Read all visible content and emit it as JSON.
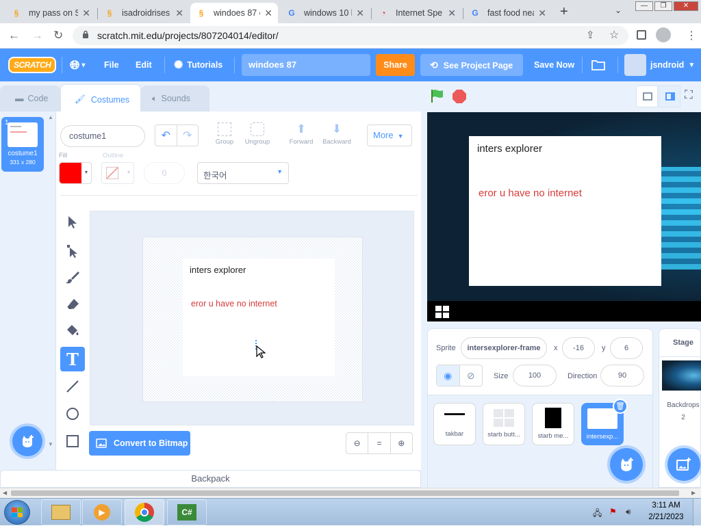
{
  "browser": {
    "tabs": [
      {
        "title": "my pass on S",
        "favicon": "scratch-favicon",
        "active": false
      },
      {
        "title": "isadroidrises",
        "favicon": "scratch-favicon",
        "active": false
      },
      {
        "title": "windoes 87 o",
        "favicon": "scratch-favicon",
        "active": true
      },
      {
        "title": "windows 10 l",
        "favicon": "google-favicon",
        "active": false
      },
      {
        "title": "Internet Spe",
        "favicon": "speedtest-favicon",
        "active": false
      },
      {
        "title": "fast food nea",
        "favicon": "google-favicon",
        "active": false
      }
    ],
    "url": "scratch.mit.edu/projects/807204014/editor/"
  },
  "menubar": {
    "logo": "SCRATCH",
    "file": "File",
    "edit": "Edit",
    "tutorials": "Tutorials",
    "project_title": "windoes 87",
    "share": "Share",
    "see_project": "See Project Page",
    "save_now": "Save Now",
    "username": "jsndroid"
  },
  "editor_tabs": {
    "code": "Code",
    "costumes": "Costumes",
    "sounds": "Sounds"
  },
  "costume_list": [
    {
      "number": "1",
      "name": "costume1",
      "size": "331 x 280"
    }
  ],
  "paint": {
    "costume_name": "costume1",
    "group": "Group",
    "ungroup": "Ungroup",
    "forward": "Forward",
    "backward": "Backward",
    "more": "More",
    "fill_label": "Fill",
    "outline_label": "Outline",
    "outline_width": "0",
    "font": "한국어",
    "fill_color": "#ff0000",
    "convert": "Convert to Bitmap",
    "canvas_title": "inters explorer",
    "canvas_message": "eror u have no internet"
  },
  "backpack": "Backpack",
  "stage": {
    "window_title": "inters explorer",
    "window_message": "eror u have no internet"
  },
  "sprite_info": {
    "sprite_label": "Sprite",
    "sprite_name": "intersexplorer-frame",
    "x_label": "x",
    "x": "-16",
    "y_label": "y",
    "y": "6",
    "show_label": "Show",
    "size_label": "Size",
    "size": "100",
    "direction_label": "Direction",
    "direction": "90"
  },
  "sprites": [
    {
      "name": "takbar"
    },
    {
      "name": "starb butt..."
    },
    {
      "name": "starb me..."
    },
    {
      "name": "intersexp..."
    }
  ],
  "stage_panel": {
    "label": "Stage",
    "backdrops_label": "Backdrops",
    "backdrops_count": "2"
  },
  "taskbar": {
    "time": "3:11 AM",
    "date": "2/21/2023"
  },
  "colors": {
    "scratch_blue": "#4c97ff",
    "share_orange": "#ff8c1a",
    "message_red": "#d83b3b"
  }
}
